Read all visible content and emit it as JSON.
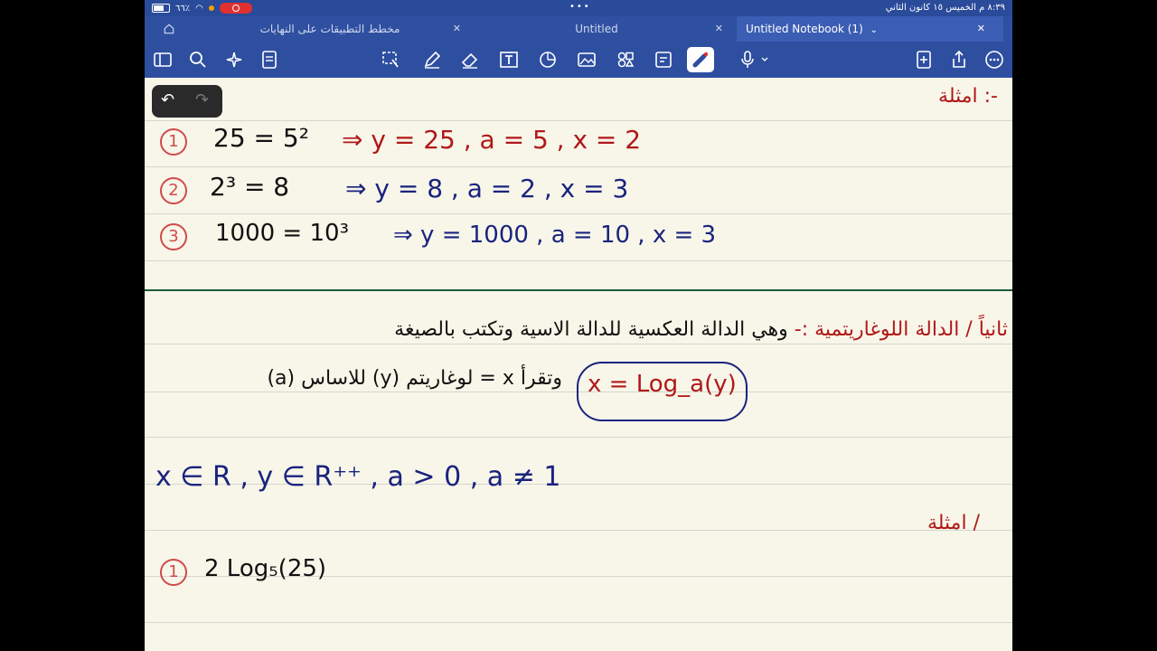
{
  "status_bar": {
    "time": "٨:٣٩ م  الخميس ١٥ كانون الثاني",
    "battery": "٦٦٪"
  },
  "tabs": [
    {
      "label": "مخطط التطبيقات على النهايات",
      "active": false
    },
    {
      "label": "Untitled",
      "active": false
    },
    {
      "label": "Untitled Notebook (1)",
      "active": true
    }
  ],
  "toolbar": {
    "left_icons": [
      "sidebar-icon",
      "search-icon",
      "sparkle-icon",
      "document-icon"
    ],
    "center_icons": [
      "lasso-icon",
      "pen-icon",
      "eraser-icon",
      "textbox-icon",
      "shapes-icon",
      "image-icon",
      "stickers-icon",
      "note-icon",
      "laser-icon"
    ],
    "right_icons": [
      "microphone-icon",
      "add-page-icon",
      "share-icon",
      "more-icon"
    ],
    "accent": "#2e4fa0"
  },
  "notes": {
    "examples_header": "امثلة :-",
    "ex1_num": "1",
    "ex1_expr": "25 = 5²",
    "ex1_result": "⇒  y = 25  ,  a = 5  ,  x = 2",
    "ex2_num": "2",
    "ex2_expr": "2³ = 8",
    "ex2_result": "⇒  y = 8  ,  a = 2  ,  x = 3",
    "ex3_num": "3",
    "ex3_expr": "1000 = 10³",
    "ex3_result": "⇒  y = 1000  ,  a = 10  ,  x = 3",
    "log_heading": "ثانياً / الدالة اللوغاريتمية :-",
    "log_desc": "وهي الدالة العكسية للدالة الاسية وتكتب بالصيغة",
    "log_formula": "x = Log_a(y)",
    "log_reading": "وتقرأ  x = لوغاريتم (y) للاساس (a)",
    "domain_line": "x ∈ R  ,  y ∈ R⁺⁺  ,  a > 0 , a ≠ 1",
    "examples_header_2": "امثلة /",
    "ex4_num": "1",
    "ex4_expr": "2 Log₅(25)"
  }
}
